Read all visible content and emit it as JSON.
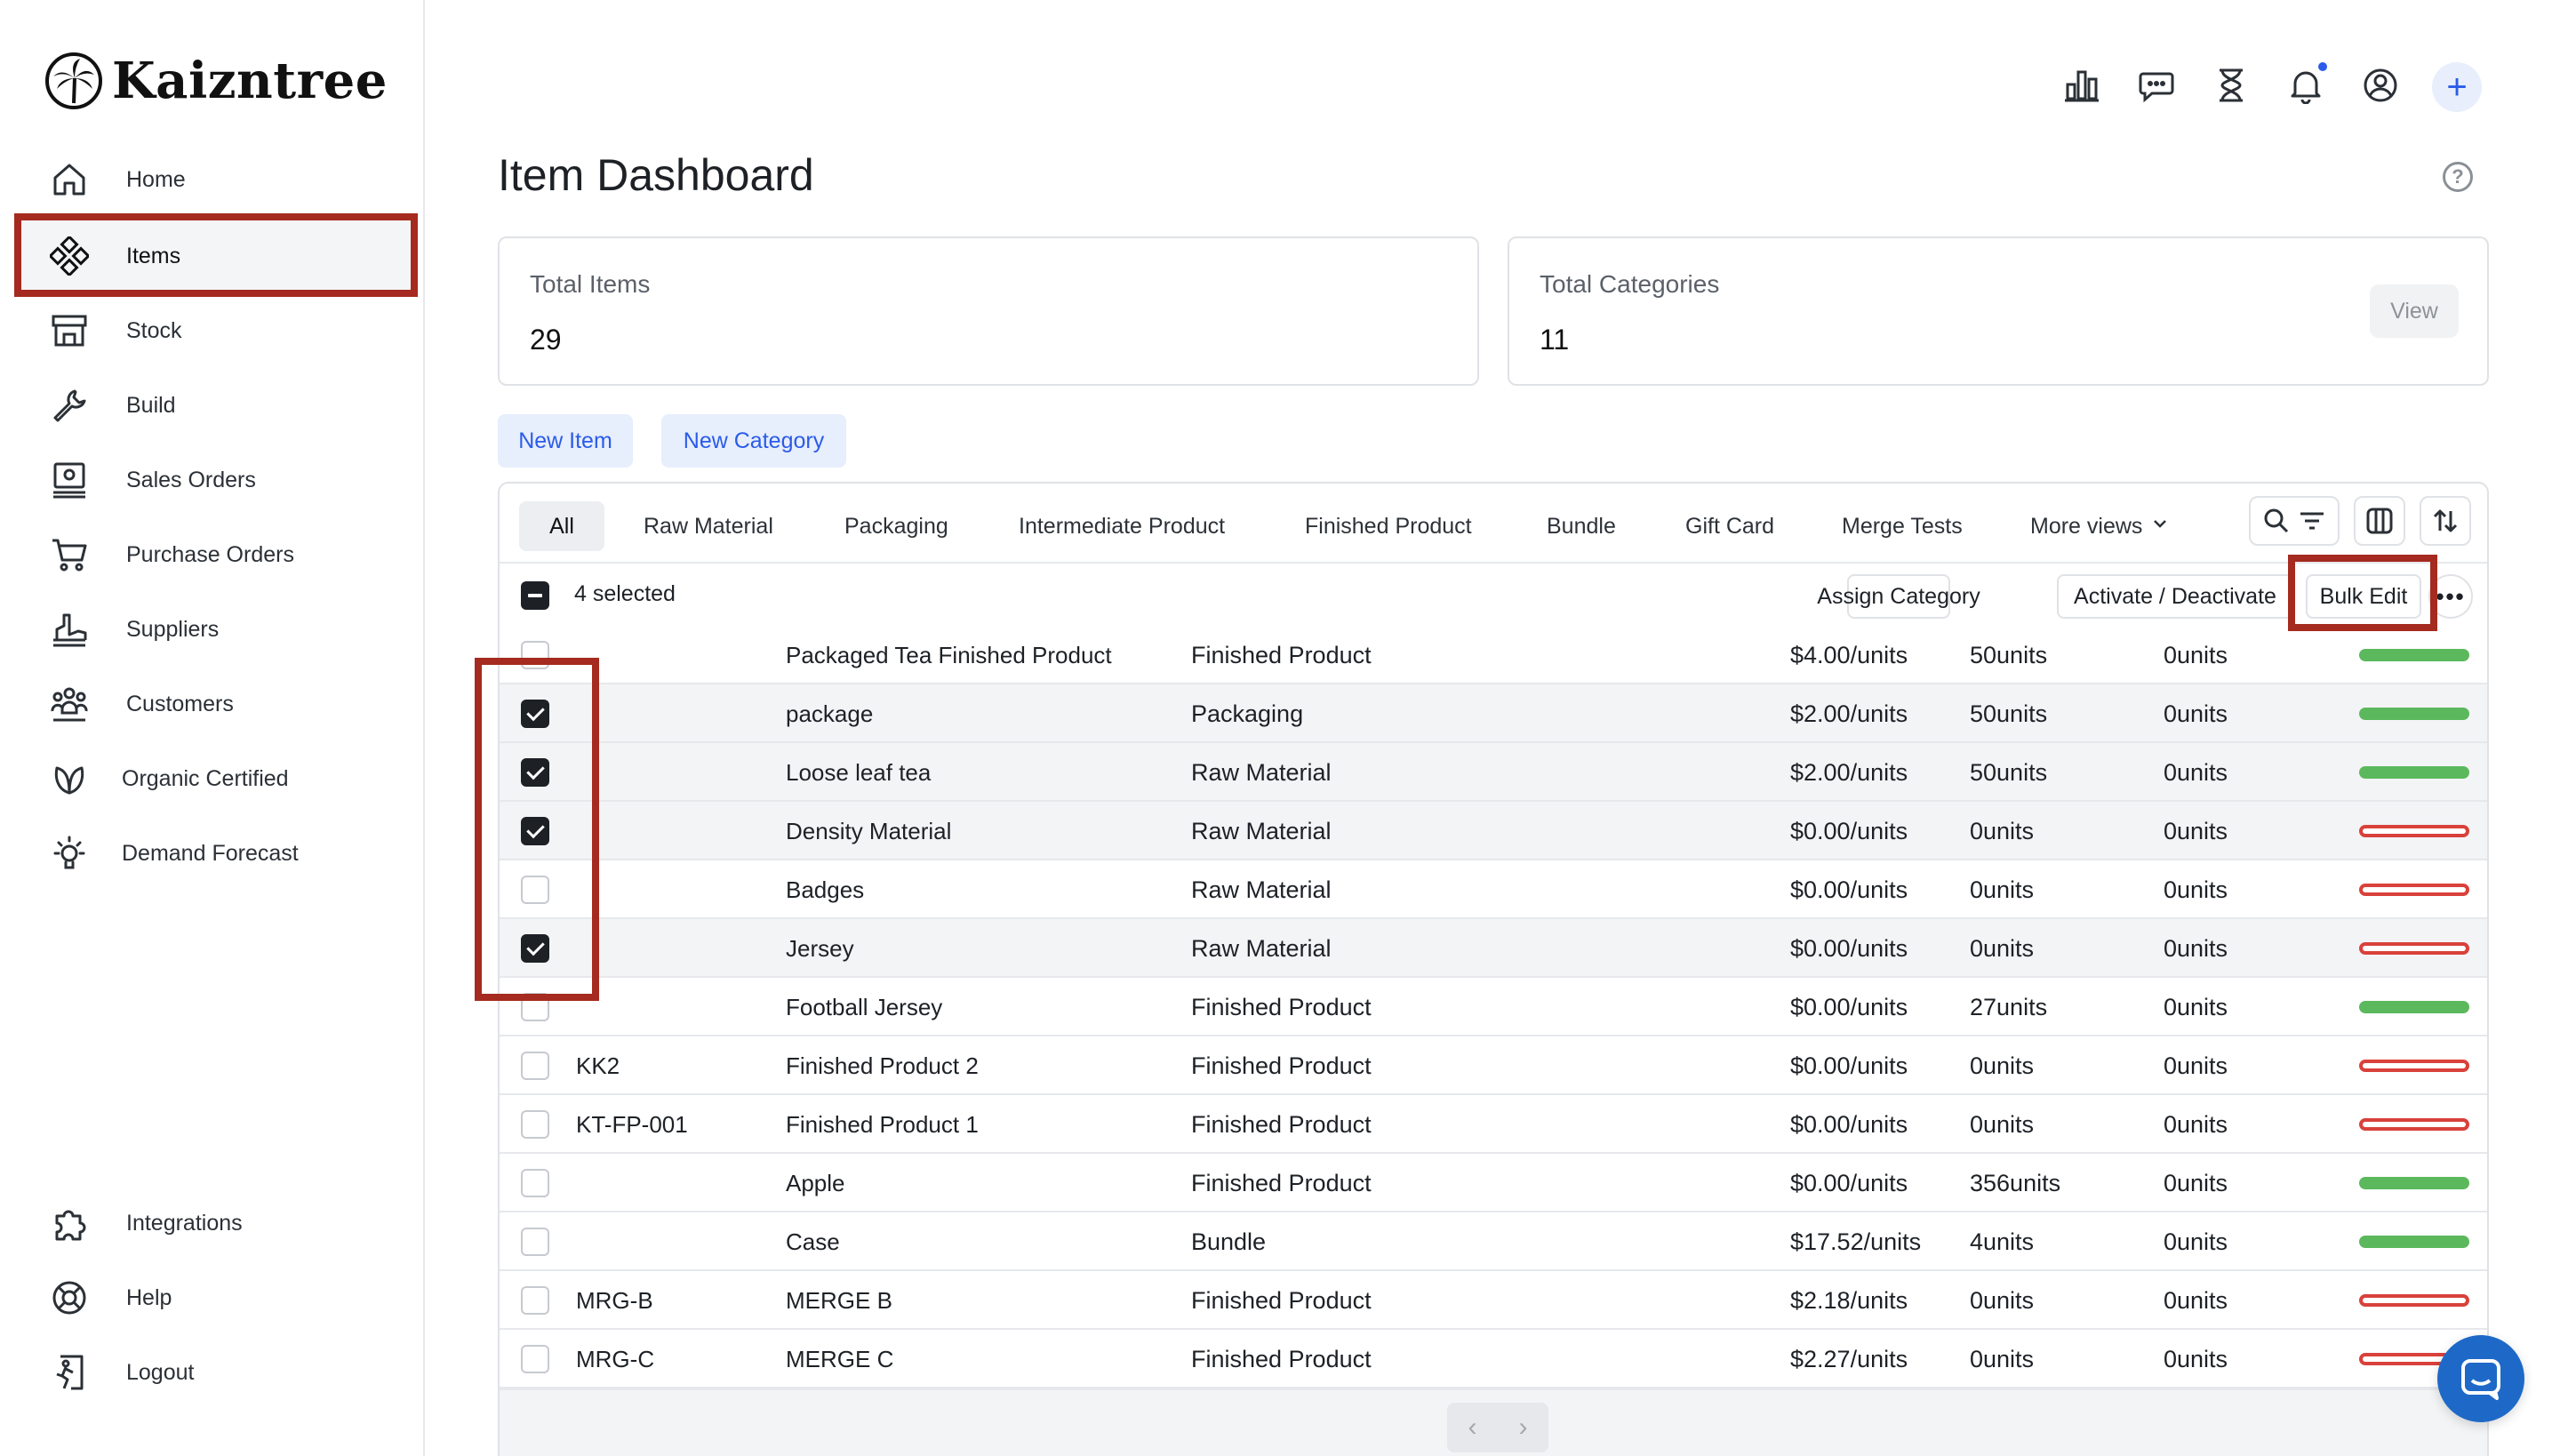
{
  "brand": {
    "name": "Kaizntree"
  },
  "sidebar": {
    "items": [
      {
        "label": "Home",
        "icon": "home-icon"
      },
      {
        "label": "Items",
        "icon": "items-icon",
        "active": true
      },
      {
        "label": "Stock",
        "icon": "stock-icon"
      },
      {
        "label": "Build",
        "icon": "wrench-icon"
      },
      {
        "label": "Sales Orders",
        "icon": "sales-orders-icon"
      },
      {
        "label": "Purchase Orders",
        "icon": "cart-icon"
      },
      {
        "label": "Suppliers",
        "icon": "suppliers-icon"
      },
      {
        "label": "Customers",
        "icon": "customers-icon"
      },
      {
        "label": "Organic Certified",
        "icon": "leaf-icon"
      },
      {
        "label": "Demand Forecast",
        "icon": "lightbulb-icon"
      }
    ],
    "bottom_items": [
      {
        "label": "Integrations",
        "icon": "puzzle-icon"
      },
      {
        "label": "Help",
        "icon": "lifebuoy-icon"
      },
      {
        "label": "Logout",
        "icon": "logout-icon"
      }
    ]
  },
  "topbar": {
    "icons": [
      "analytics-icon",
      "messages-icon",
      "hourglass-icon",
      "bell-icon",
      "user-icon",
      "plus-icon"
    ],
    "plus_label": "+",
    "help_label": "?"
  },
  "page": {
    "title": "Item Dashboard"
  },
  "stats": {
    "total_items": {
      "label": "Total Items",
      "value": "29"
    },
    "total_categories": {
      "label": "Total Categories",
      "value": "11",
      "view_label": "View"
    }
  },
  "actions": {
    "new_item": "New Item",
    "new_category": "New Category"
  },
  "tabs": [
    "All",
    "Raw Material",
    "Packaging",
    "Intermediate Product",
    "Finished Product",
    "Bundle",
    "Gift Card",
    "Merge Tests",
    "More views"
  ],
  "active_tab": "All",
  "selection": {
    "count_label": "4 selected",
    "assign_category": "Assign Category",
    "activate_deactivate": "Activate / Deactivate",
    "bulk_edit": "Bulk Edit",
    "more": "•••"
  },
  "table": {
    "rows": [
      {
        "checked": false,
        "code": "",
        "name": "Packaged Tea Finished Product",
        "category": "Finished Product",
        "cost": "$4.00/units",
        "stock": "50units",
        "reserved": "0units",
        "status": "active"
      },
      {
        "checked": true,
        "code": "",
        "name": "package",
        "category": "Packaging",
        "cost": "$2.00/units",
        "stock": "50units",
        "reserved": "0units",
        "status": "active"
      },
      {
        "checked": true,
        "code": "",
        "name": "Loose leaf tea",
        "category": "Raw Material",
        "cost": "$2.00/units",
        "stock": "50units",
        "reserved": "0units",
        "status": "active"
      },
      {
        "checked": true,
        "code": "",
        "name": "Density Material",
        "category": "Raw Material",
        "cost": "$0.00/units",
        "stock": "0units",
        "reserved": "0units",
        "status": "inactive"
      },
      {
        "checked": false,
        "code": "",
        "name": "Badges",
        "category": "Raw Material",
        "cost": "$0.00/units",
        "stock": "0units",
        "reserved": "0units",
        "status": "inactive"
      },
      {
        "checked": true,
        "code": "",
        "name": "Jersey",
        "category": "Raw Material",
        "cost": "$0.00/units",
        "stock": "0units",
        "reserved": "0units",
        "status": "inactive"
      },
      {
        "checked": false,
        "code": "",
        "name": "Football Jersey",
        "category": "Finished Product",
        "cost": "$0.00/units",
        "stock": "27units",
        "reserved": "0units",
        "status": "active"
      },
      {
        "checked": false,
        "code": "KK2",
        "name": "Finished Product 2",
        "category": "Finished Product",
        "cost": "$0.00/units",
        "stock": "0units",
        "reserved": "0units",
        "status": "inactive"
      },
      {
        "checked": false,
        "code": "KT-FP-001",
        "name": "Finished Product 1",
        "category": "Finished Product",
        "cost": "$0.00/units",
        "stock": "0units",
        "reserved": "0units",
        "status": "inactive"
      },
      {
        "checked": false,
        "code": "",
        "name": "Apple",
        "category": "Finished Product",
        "cost": "$0.00/units",
        "stock": "356units",
        "reserved": "0units",
        "status": "active"
      },
      {
        "checked": false,
        "code": "",
        "name": "Case",
        "category": "Bundle",
        "cost": "$17.52/units",
        "stock": "4units",
        "reserved": "0units",
        "status": "active"
      },
      {
        "checked": false,
        "code": "MRG-B",
        "name": "MERGE B",
        "category": "Finished Product",
        "cost": "$2.18/units",
        "stock": "0units",
        "reserved": "0units",
        "status": "inactive"
      },
      {
        "checked": false,
        "code": "MRG-C",
        "name": "MERGE C",
        "category": "Finished Product",
        "cost": "$2.27/units",
        "stock": "0units",
        "reserved": "0units",
        "status": "inactive"
      }
    ]
  },
  "pagination": {
    "prev": "‹",
    "next": "›"
  },
  "colors": {
    "accent": "#2b5be8",
    "active_status": "#5cb85c",
    "inactive_status": "#d9413b",
    "highlight": "#a52a1f",
    "chat": "#1e69c8"
  }
}
